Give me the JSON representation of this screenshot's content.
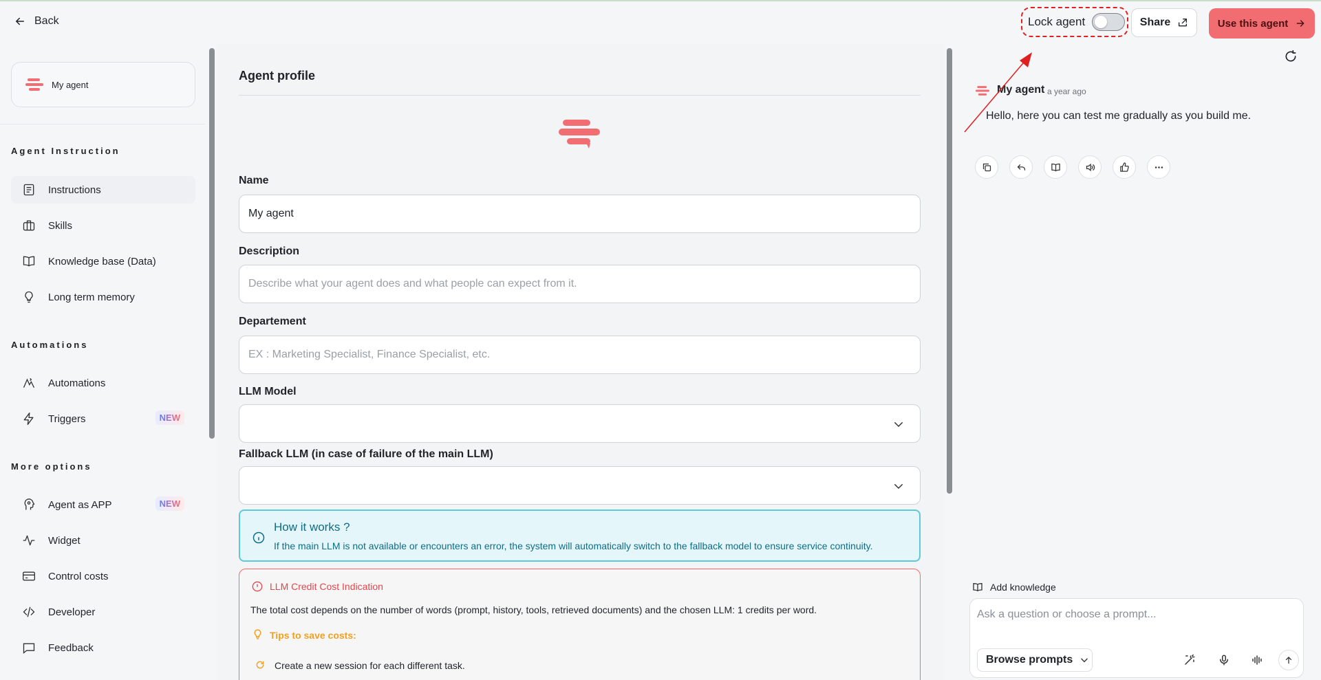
{
  "header": {
    "back_label": "Back",
    "lock_label": "Lock agent",
    "lock_enabled": false,
    "share_label": "Share",
    "use_label": "Use this agent"
  },
  "sidebar": {
    "agent_name": "My agent",
    "sections": [
      {
        "title": "Agent Instruction",
        "items": [
          {
            "label": "Instructions",
            "icon": "instructions-icon"
          },
          {
            "label": "Skills",
            "icon": "briefcase-icon"
          },
          {
            "label": "Knowledge base (Data)",
            "icon": "book-icon"
          },
          {
            "label": "Long term memory",
            "icon": "lightbulb-icon"
          }
        ]
      },
      {
        "title": "Automations",
        "items": [
          {
            "label": "Automations",
            "icon": "automation-icon"
          },
          {
            "label": "Triggers",
            "icon": "bolt-icon",
            "badge": "NEW"
          }
        ]
      },
      {
        "title": "More options",
        "items": [
          {
            "label": "Agent as APP",
            "icon": "head-icon",
            "badge": "NEW"
          },
          {
            "label": "Widget",
            "icon": "pulse-icon"
          },
          {
            "label": "Control costs",
            "icon": "card-icon"
          },
          {
            "label": "Developer",
            "icon": "code-icon"
          },
          {
            "label": "Feedback",
            "icon": "comment-icon"
          }
        ]
      }
    ]
  },
  "form": {
    "title": "Agent profile",
    "name_label": "Name",
    "name_value": "My agent",
    "description_label": "Description",
    "description_placeholder": "Describe what your agent does and what people can expect from it.",
    "department_label": "Departement",
    "department_placeholder": "EX : Marketing Specialist, Finance Specialist, etc.",
    "llm_label": "LLM Model",
    "fallback_label": "Fallback LLM (in case of failure of the main LLM)",
    "info_title": "How it works ?",
    "info_text": "If the main LLM is not available or encounters an error, the system will automatically switch to the fallback model to ensure service continuity.",
    "cost_title": "LLM Credit Cost Indication",
    "cost_text": "The total cost depends on the number of words (prompt, history, tools, retrieved documents) and the chosen LLM: 1 credits per word.",
    "tips_title": "Tips to save costs:",
    "tips": [
      "Create a new session for each different task."
    ]
  },
  "chat": {
    "agent_name": "My agent",
    "time": "a year ago",
    "message": "Hello, here you can test me gradually as you build me.",
    "add_knowledge": "Add knowledge",
    "input_placeholder": "Ask a question or choose a prompt...",
    "browse_label": "Browse prompts"
  },
  "colors": {
    "accent": "#f26d72",
    "info": "#5cc8d8",
    "warning": "#f0a020",
    "annotation": "#e02020"
  }
}
